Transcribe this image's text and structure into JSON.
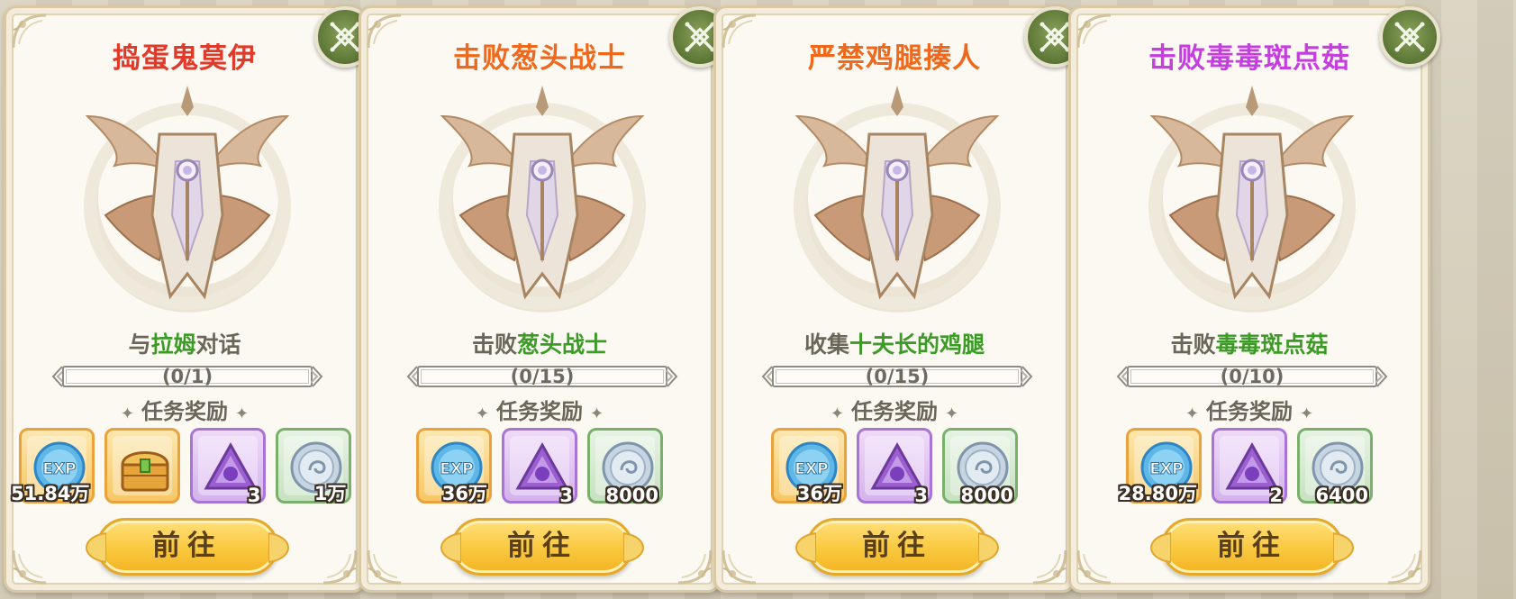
{
  "colors": {
    "title_red": "#e23a2a",
    "title_orange": "#f0681c",
    "title_purple": "#c53fe0",
    "highlight_green": "#3c9a27",
    "button_gold": "#f9c83e",
    "cancel_green": "#5c7636"
  },
  "labels": {
    "rewards_title": "任务奖励",
    "go_button": "前往",
    "star": "✦"
  },
  "quests": [
    {
      "title": "捣蛋鬼莫伊",
      "title_color": "#e23a2a",
      "objective_prefix": "与",
      "objective_highlight": "拉姆",
      "objective_suffix": "对话",
      "progress_text": "(0/1)",
      "progress_fraction": 0,
      "rewards": [
        {
          "icon": "exp-icon",
          "frame": "orange",
          "qty": "51.84万"
        },
        {
          "icon": "treasure-chest-icon",
          "frame": "orange",
          "qty": ""
        },
        {
          "icon": "purple-crystal-icon",
          "frame": "purple",
          "qty": "3"
        },
        {
          "icon": "silver-coin-icon",
          "frame": "green",
          "qty": "1万"
        }
      ]
    },
    {
      "title": "击败葱头战士",
      "title_color": "#f0681c",
      "objective_prefix": "击败",
      "objective_highlight": "葱头战士",
      "objective_suffix": "",
      "progress_text": "(0/15)",
      "progress_fraction": 0,
      "rewards": [
        {
          "icon": "exp-icon",
          "frame": "orange",
          "qty": "36万"
        },
        {
          "icon": "purple-crystal-icon",
          "frame": "purple",
          "qty": "3"
        },
        {
          "icon": "silver-coin-icon",
          "frame": "green",
          "qty": "8000"
        }
      ]
    },
    {
      "title": "严禁鸡腿揍人",
      "title_color": "#f0681c",
      "objective_prefix": "收集",
      "objective_highlight": "十夫长的鸡腿",
      "objective_suffix": "",
      "progress_text": "(0/15)",
      "progress_fraction": 0,
      "rewards": [
        {
          "icon": "exp-icon",
          "frame": "orange",
          "qty": "36万"
        },
        {
          "icon": "purple-crystal-icon",
          "frame": "purple",
          "qty": "3"
        },
        {
          "icon": "silver-coin-icon",
          "frame": "green",
          "qty": "8000"
        }
      ]
    },
    {
      "title": "击败毒毒斑点菇",
      "title_color": "#c53fe0",
      "objective_prefix": "击败",
      "objective_highlight": "毒毒斑点菇",
      "objective_suffix": "",
      "progress_text": "(0/10)",
      "progress_fraction": 0,
      "rewards": [
        {
          "icon": "exp-icon",
          "frame": "orange",
          "qty": "28.80万"
        },
        {
          "icon": "purple-crystal-icon",
          "frame": "purple",
          "qty": "2"
        },
        {
          "icon": "silver-coin-icon",
          "frame": "green",
          "qty": "6400"
        }
      ]
    }
  ]
}
